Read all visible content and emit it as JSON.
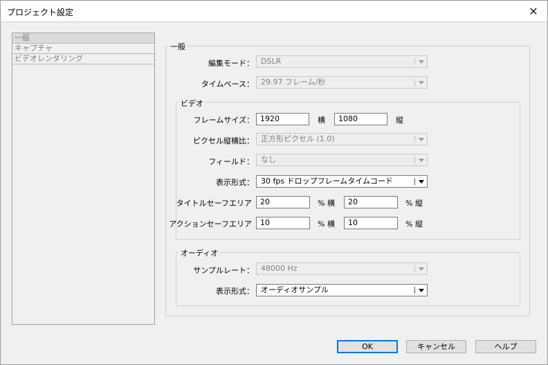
{
  "window": {
    "title": "プロジェクト設定",
    "close_glyph": "✕"
  },
  "sidebar": {
    "items": [
      {
        "label": "一般",
        "selected": true
      },
      {
        "label": "キャプチャ",
        "selected": false
      },
      {
        "label": "ビデオレンダリング",
        "selected": false
      }
    ]
  },
  "general": {
    "group_label": "一般",
    "edit_mode": {
      "label": "編集モード：",
      "value": "DSLR"
    },
    "timebase": {
      "label": "タイムベース：",
      "value": "29.97 フレーム/秒"
    }
  },
  "video": {
    "group_label": "ビデオ",
    "frame_size": {
      "label": "フレームサイズ：",
      "width": "1920",
      "width_unit": "横",
      "height": "1080",
      "height_unit": "縦"
    },
    "pixel_aspect": {
      "label": "ピクセル縦横比：",
      "value": "正方形ピクセル (1.0)"
    },
    "fields": {
      "label": "フィールド：",
      "value": "なし"
    },
    "display_format": {
      "label": "表示形式：",
      "value": "30 fps ドロップフレームタイムコード"
    },
    "title_safe": {
      "label": "タイトルセーフエリア",
      "h": "20",
      "h_unit": "% 横",
      "v": "20",
      "v_unit": "% 縦"
    },
    "action_safe": {
      "label": "アクションセーフエリア",
      "h": "10",
      "h_unit": "% 横",
      "v": "10",
      "v_unit": "% 縦"
    }
  },
  "audio": {
    "group_label": "オーディオ",
    "sample_rate": {
      "label": "サンプルレート：",
      "value": "48000 Hz"
    },
    "display_format": {
      "label": "表示形式：",
      "value": "オーディオサンプル"
    }
  },
  "buttons": {
    "ok": "OK",
    "cancel": "キャンセル",
    "help": "ヘルプ"
  }
}
